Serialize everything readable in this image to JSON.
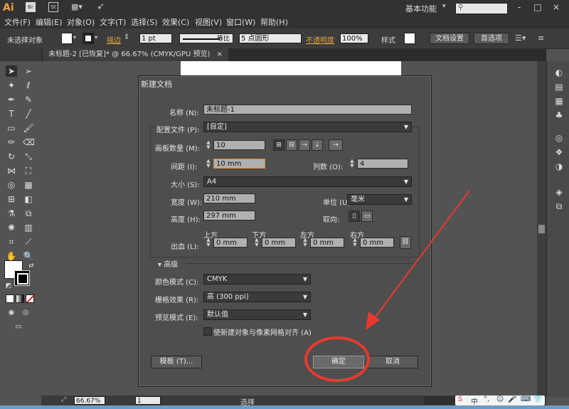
{
  "app": {
    "logo": "Ai",
    "workspace": "基本功能",
    "search_placeholder": "",
    "window_controls": [
      "-",
      "□",
      "×"
    ]
  },
  "menubar": [
    "文件(F)",
    "编辑(E)",
    "对象(O)",
    "文字(T)",
    "选择(S)",
    "效果(C)",
    "视图(V)",
    "窗口(W)",
    "帮助(H)"
  ],
  "controlbar": {
    "selection": "未选择对象",
    "stroke_label": "描边",
    "stroke_weight": "1 pt",
    "stroke_style": "等比",
    "brush": "5 点圆形",
    "opacity_label": "不透明度",
    "opacity": "100%",
    "style_label": "样式",
    "doc_setup": "文档设置",
    "preferences": "首选项"
  },
  "tab": {
    "title": "未标题-2 [已恢复]* @ 66.67% (CMYK/GPU 预览)",
    "close": "×"
  },
  "status": {
    "zoom": "66.67%",
    "page": "1",
    "mode": "选择"
  },
  "dialog": {
    "title": "新建文档",
    "name_label": "名称 (N):",
    "name_value": "未标题-1",
    "profile_label": "配置文件 (P):",
    "profile_value": "[自定]",
    "artboards_label": "画板数量 (M):",
    "artboards_value": "10",
    "spacing_label": "间距 (I):",
    "spacing_value": "10 mm",
    "columns_label": "列数 (O):",
    "columns_value": "4",
    "size_label": "大小 (S):",
    "size_value": "A4",
    "width_label": "宽度 (W):",
    "width_value": "210 mm",
    "units_label": "单位 (U):",
    "units_value": "毫米",
    "height_label": "高度 (H):",
    "height_value": "297 mm",
    "orientation_label": "取向:",
    "bleed_label": "出血 (L):",
    "bleed_top_label": "上方",
    "bleed_bottom_label": "下方",
    "bleed_left_label": "左方",
    "bleed_right_label": "右方",
    "bleed_top": "0 mm",
    "bleed_bottom": "0 mm",
    "bleed_left": "0 mm",
    "bleed_right": "0 mm",
    "advanced_label": "高级",
    "color_mode_label": "颜色模式 (C):",
    "color_mode_value": "CMYK",
    "raster_label": "栅格效果 (R):",
    "raster_value": "高 (300 ppi)",
    "preview_label": "预览模式 (E):",
    "preview_value": "默认值",
    "align_label": "使新建对象与像素网格对齐 (A)",
    "templates_button": "模板 (T)...",
    "ok_button": "确定",
    "cancel_button": "取消"
  },
  "colors": {
    "annotation": "#e8392f",
    "accent": "#e8a33c"
  }
}
